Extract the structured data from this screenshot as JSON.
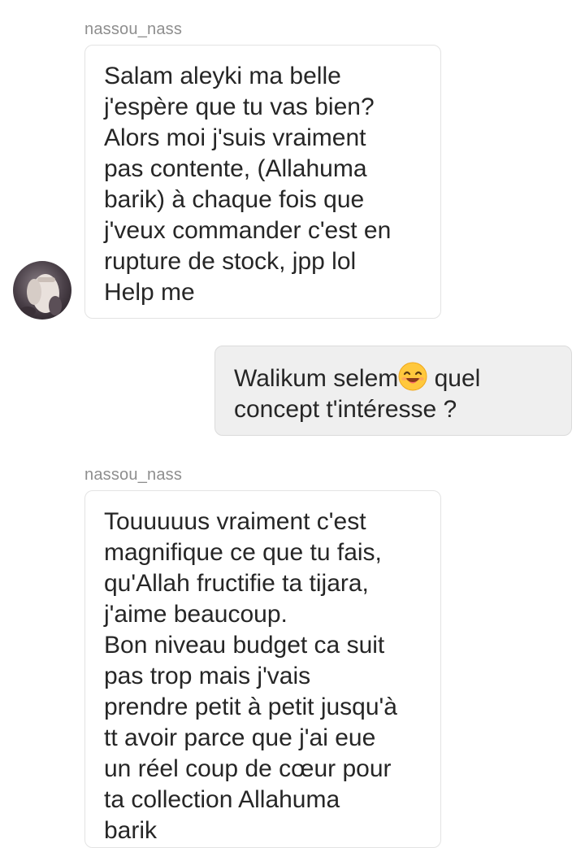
{
  "thread": {
    "messages": [
      {
        "username": "nassou_nass",
        "lines": [
          "Salam aleyki ma belle",
          "j'espère que tu vas bien?",
          "Alors moi j'suis vraiment",
          "pas contente, (Allahuma",
          "barik) à chaque fois que",
          "j'veux commander c'est en",
          "rupture de stock, jpp lol",
          "Help me"
        ]
      },
      {
        "line1_before_emoji": "Walikum selem",
        "emoji": "smiling-face-emoji",
        "line1_after_emoji": " quel",
        "line2": "concept t'intéresse ?"
      },
      {
        "username": "nassou_nass",
        "lines": [
          "Touuuuus vraiment c'est",
          "magnifique ce que tu fais,",
          "qu'Allah fructifie ta tijara,",
          "j'aime beaucoup.",
          "Bon niveau budget ca suit",
          "pas trop mais j'vais",
          "prendre petit à petit jusqu'à",
          "tt avoir parce que j'ai eue",
          "un réel coup de cœur pour",
          "ta collection Allahuma",
          "barik"
        ]
      }
    ]
  },
  "colors": {
    "username": "#8e8e8e",
    "text": "#262626",
    "incoming_bubble_bg": "#ffffff",
    "incoming_bubble_border": "#e3e3e3",
    "outgoing_bubble_bg": "#efefef",
    "outgoing_bubble_border": "#dbdbdb"
  }
}
